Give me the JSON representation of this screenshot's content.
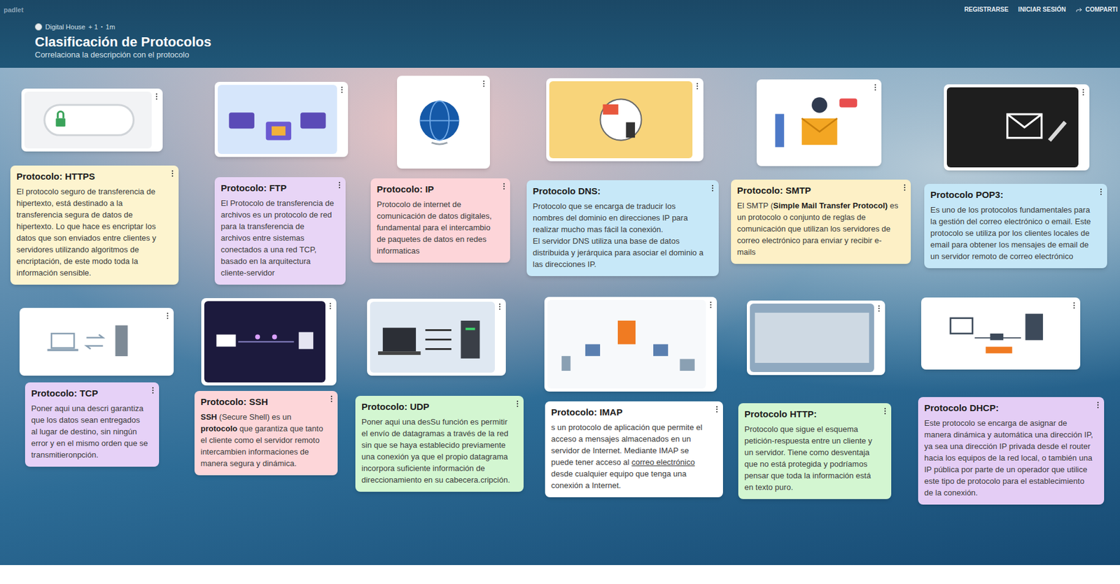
{
  "app": {
    "brand": "padlet"
  },
  "nav": [
    {
      "label": "REGISTRARSE",
      "kind": "link"
    },
    {
      "label": "INICIAR SESIÓN",
      "kind": "link"
    },
    {
      "label": "COMPARTI",
      "kind": "share"
    }
  ],
  "board": {
    "author": "Digital House",
    "contributors": "+ 1",
    "separator": "•",
    "age": "1m",
    "title": "Clasificación de Protocolos",
    "subtitle": "Correlaciona la descripción con el protocolo"
  },
  "posts": [
    {
      "title": "Protocolo: HTTPS",
      "color": "#fdf4cf",
      "body": [
        [
          {
            "text": "El protocolo seguro de transferencia de hipertexto, está destinado a la transferencia segura de datos de hipertexto. Lo que hace es encriptar los datos que son enviados entre clientes y servidores utilizando algoritmos de encriptación, de este modo toda la información sensible.",
            "bold": false,
            "underline": false
          }
        ]
      ]
    },
    {
      "title": "Protocolo: FTP",
      "color": "#e8d5f6",
      "body": [
        [
          {
            "text": "El Protocolo de transferencia de archivos es un protocolo de red para la transferencia de archivos entre sistemas conectados a una red TCP, basado en la arquitectura cliente-servidor",
            "bold": false,
            "underline": false
          }
        ]
      ]
    },
    {
      "title": "Protocolo: IP",
      "color": "#fdd5d9",
      "body": [
        [
          {
            "text": "Protocolo de internet de comunicación de datos digitales, fundamental para el intercambio de paquetes de datos en redes informaticas",
            "bold": false,
            "underline": false
          }
        ]
      ]
    },
    {
      "title": "Protocolo DNS:",
      "color": "#c7e8f8",
      "body": [
        [
          {
            "text": "Protocolo que se encarga de traducir los nombres del dominio en direcciones IP para realizar mucho mas fácil la conexión.",
            "bold": false,
            "underline": false
          }
        ],
        [
          {
            "text": "El servidor DNS utiliza una base de datos distribuida y jerárquica para asociar el dominio a las direcciones IP.",
            "bold": false,
            "underline": false
          }
        ]
      ]
    },
    {
      "title": "Protocolo: SMTP",
      "color": "#fdf0c6",
      "body": [
        [
          {
            "text": "El SMTP (",
            "bold": false,
            "underline": false
          },
          {
            "text": "Simple Mail Transfer Protocol)",
            "bold": true,
            "underline": false
          },
          {
            "text": " es un protocolo o conjunto de reglas de comunicación que utilizan los servidores de correo electrónico para enviar y recibir e-mails",
            "bold": false,
            "underline": false
          }
        ]
      ]
    },
    {
      "title": "Protocolo POP3:",
      "color": "#c5e7f7",
      "body": [
        [
          {
            "text": "Es uno de los protocolos fundamentales para la gestión del correo electrónico o email. Este protocolo se utiliza por los clientes locales de email para obtener los mensajes de email de un servidor remoto de correo electrónico",
            "bold": false,
            "underline": false
          }
        ]
      ]
    },
    {
      "title": "Protocolo: TCP",
      "color": "#e6d1f7",
      "body": [
        [
          {
            "text": "Poner aqui una descri garantiza que los datos sean entregados al lugar de destino, sin ningún error y en el mismo orden que se transmitieronpción.",
            "bold": false,
            "underline": false
          }
        ]
      ]
    },
    {
      "title": "Protocolo: SSH",
      "color": "#fdd6d9",
      "body": [
        [
          {
            "text": "SSH",
            "bold": true,
            "underline": false
          },
          {
            "text": " (Secure Shell) es un ",
            "bold": false,
            "underline": false
          },
          {
            "text": "protocolo",
            "bold": true,
            "underline": false
          },
          {
            "text": " que garantiza que tanto el cliente como el servidor remoto intercambien informaciones de manera segura y dinámica.",
            "bold": false,
            "underline": false
          }
        ]
      ]
    },
    {
      "title": "Protocolo: UDP",
      "color": "#d3f6d1",
      "body": [
        [
          {
            "text": "Poner aqui una desSu función es permitir el envío de datagramas a través de la red sin que se haya establecido previamente una conexión ya que el propio datagrama incorpora suficiente información de direccionamiento en su cabecera.cripción.",
            "bold": false,
            "underline": false
          }
        ]
      ]
    },
    {
      "title": "Protocolo: IMAP",
      "color": "#ffffff",
      "body": [
        [
          {
            "text": "s un protocolo de aplicación que permite el acceso a mensajes almacenados en un servidor de Internet. Mediante IMAP se puede tener acceso al ",
            "bold": false,
            "underline": false
          },
          {
            "text": "correo electrónico",
            "bold": false,
            "underline": true
          },
          {
            "text": " desde cualquier equipo que tenga una conexión a Internet.",
            "bold": false,
            "underline": false
          }
        ]
      ]
    },
    {
      "title": "Protocolo HTTP:",
      "color": "#d3f6d1",
      "body": [
        [
          {
            "text": "Protocolo que sigue el esquema petición-respuesta entre un cliente y un servidor. Tiene como desventaja que no está protegida y podríamos pensar que toda la información está en texto puro.",
            "bold": false,
            "underline": false
          }
        ]
      ]
    },
    {
      "title": "Protocolo DHCP:",
      "color": "#e4cdf5",
      "body": [
        [
          {
            "text": "Este protocolo se encarga de asignar de manera dinámica y automática una dirección IP, ya sea una dirección IP privada desde el router hacia los equipos de la red local, o también una IP pública por parte de un operador que utilice este tipo de protocolo para el establecimiento de la conexión.",
            "bold": false,
            "underline": false
          }
        ]
      ]
    }
  ]
}
